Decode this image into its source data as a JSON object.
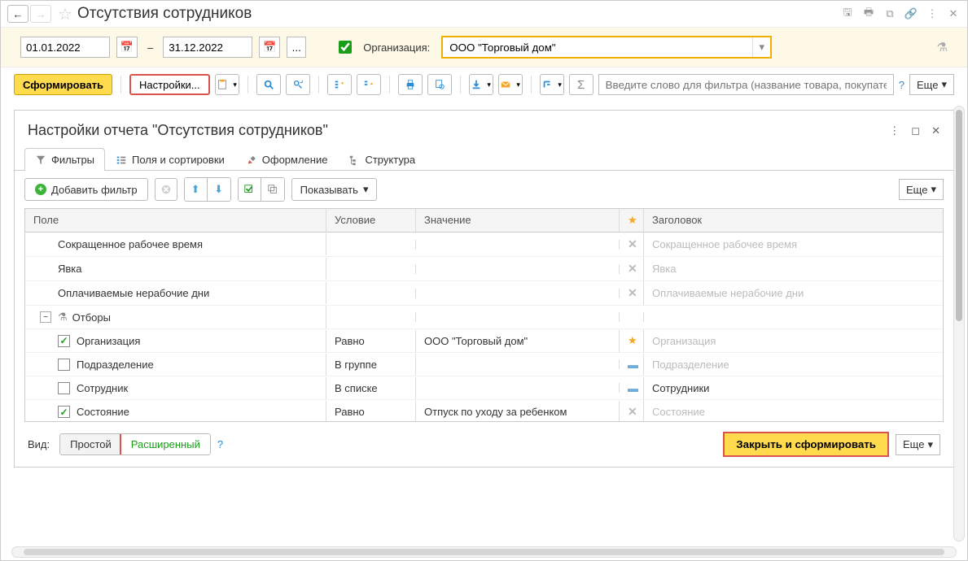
{
  "titlebar": {
    "title": "Отсутствия сотрудников"
  },
  "params": {
    "date_from": "01.01.2022",
    "date_to": "31.12.2022",
    "org_label": "Организация:",
    "org_value": "ООО \"Торговый дом\""
  },
  "toolbar": {
    "generate": "Сформировать",
    "settings": "Настройки...",
    "search_placeholder": "Введите слово для фильтра (название товара, покупателя...",
    "more": "Еще"
  },
  "panel": {
    "title": "Настройки отчета \"Отсутствия сотрудников\"",
    "tabs": {
      "filters": "Фильтры",
      "fields": "Поля и сортировки",
      "format": "Оформление",
      "structure": "Структура"
    },
    "filter_toolbar": {
      "add": "Добавить фильтр",
      "show": "Показывать",
      "more": "Еще"
    },
    "columns": {
      "field": "Поле",
      "cond": "Условие",
      "val": "Значение",
      "star": "★",
      "title": "Заголовок"
    },
    "rows": [
      {
        "field": "Сокращенное рабочее время",
        "cond": "",
        "val": "",
        "mark": "x",
        "title": "Сокращенное рабочее время",
        "muted": true
      },
      {
        "field": "Явка",
        "cond": "",
        "val": "",
        "mark": "x",
        "title": "Явка",
        "muted": true
      },
      {
        "field": "Оплачиваемые нерабочие дни",
        "cond": "",
        "val": "",
        "mark": "x",
        "title": "Оплачиваемые нерабочие дни",
        "muted": true
      }
    ],
    "group_label": "Отборы",
    "filters": [
      {
        "field": "Организация",
        "cond": "Равно",
        "val": "ООО \"Торговый дом\"",
        "mark": "star",
        "title": "Организация",
        "checked": true,
        "muted_title": true
      },
      {
        "field": "Подразделение",
        "cond": "В группе",
        "val": "",
        "mark": "dash",
        "title": "Подразделение",
        "checked": false,
        "muted_title": true
      },
      {
        "field": "Сотрудник",
        "cond": "В списке",
        "val": "",
        "mark": "dash",
        "title": "Сотрудники",
        "checked": false,
        "muted_title": false
      },
      {
        "field": "Состояние",
        "cond": "Равно",
        "val": "Отпуск по уходу за ребенком",
        "mark": "x",
        "title": "Состояние",
        "checked": true,
        "muted_title": true
      }
    ],
    "footer": {
      "view_label": "Вид:",
      "simple": "Простой",
      "extended": "Расширенный",
      "close_gen": "Закрыть и сформировать",
      "more": "Еще"
    }
  }
}
